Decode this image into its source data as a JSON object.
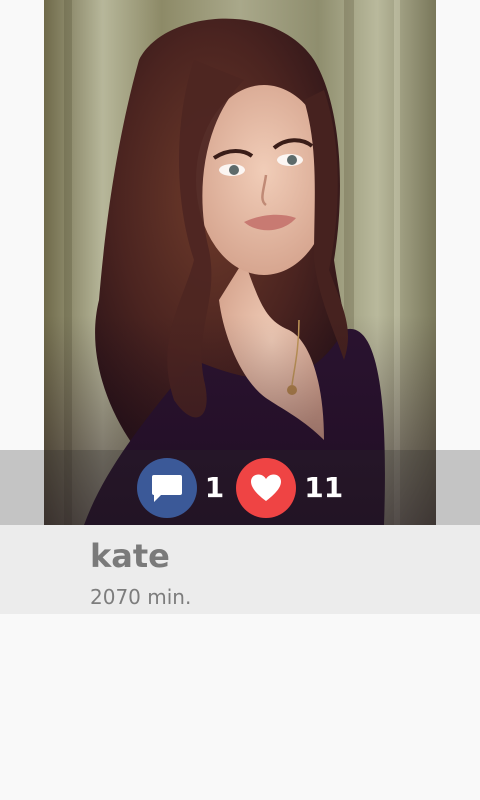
{
  "profile": {
    "name": "kate",
    "time": "2070 min."
  },
  "stats": {
    "comments": "1",
    "likes": "11",
    "comment_icon": "comment-icon",
    "like_icon": "heart-icon"
  },
  "colors": {
    "comment_accent": "#3b5998",
    "like_accent": "#ef4444"
  }
}
